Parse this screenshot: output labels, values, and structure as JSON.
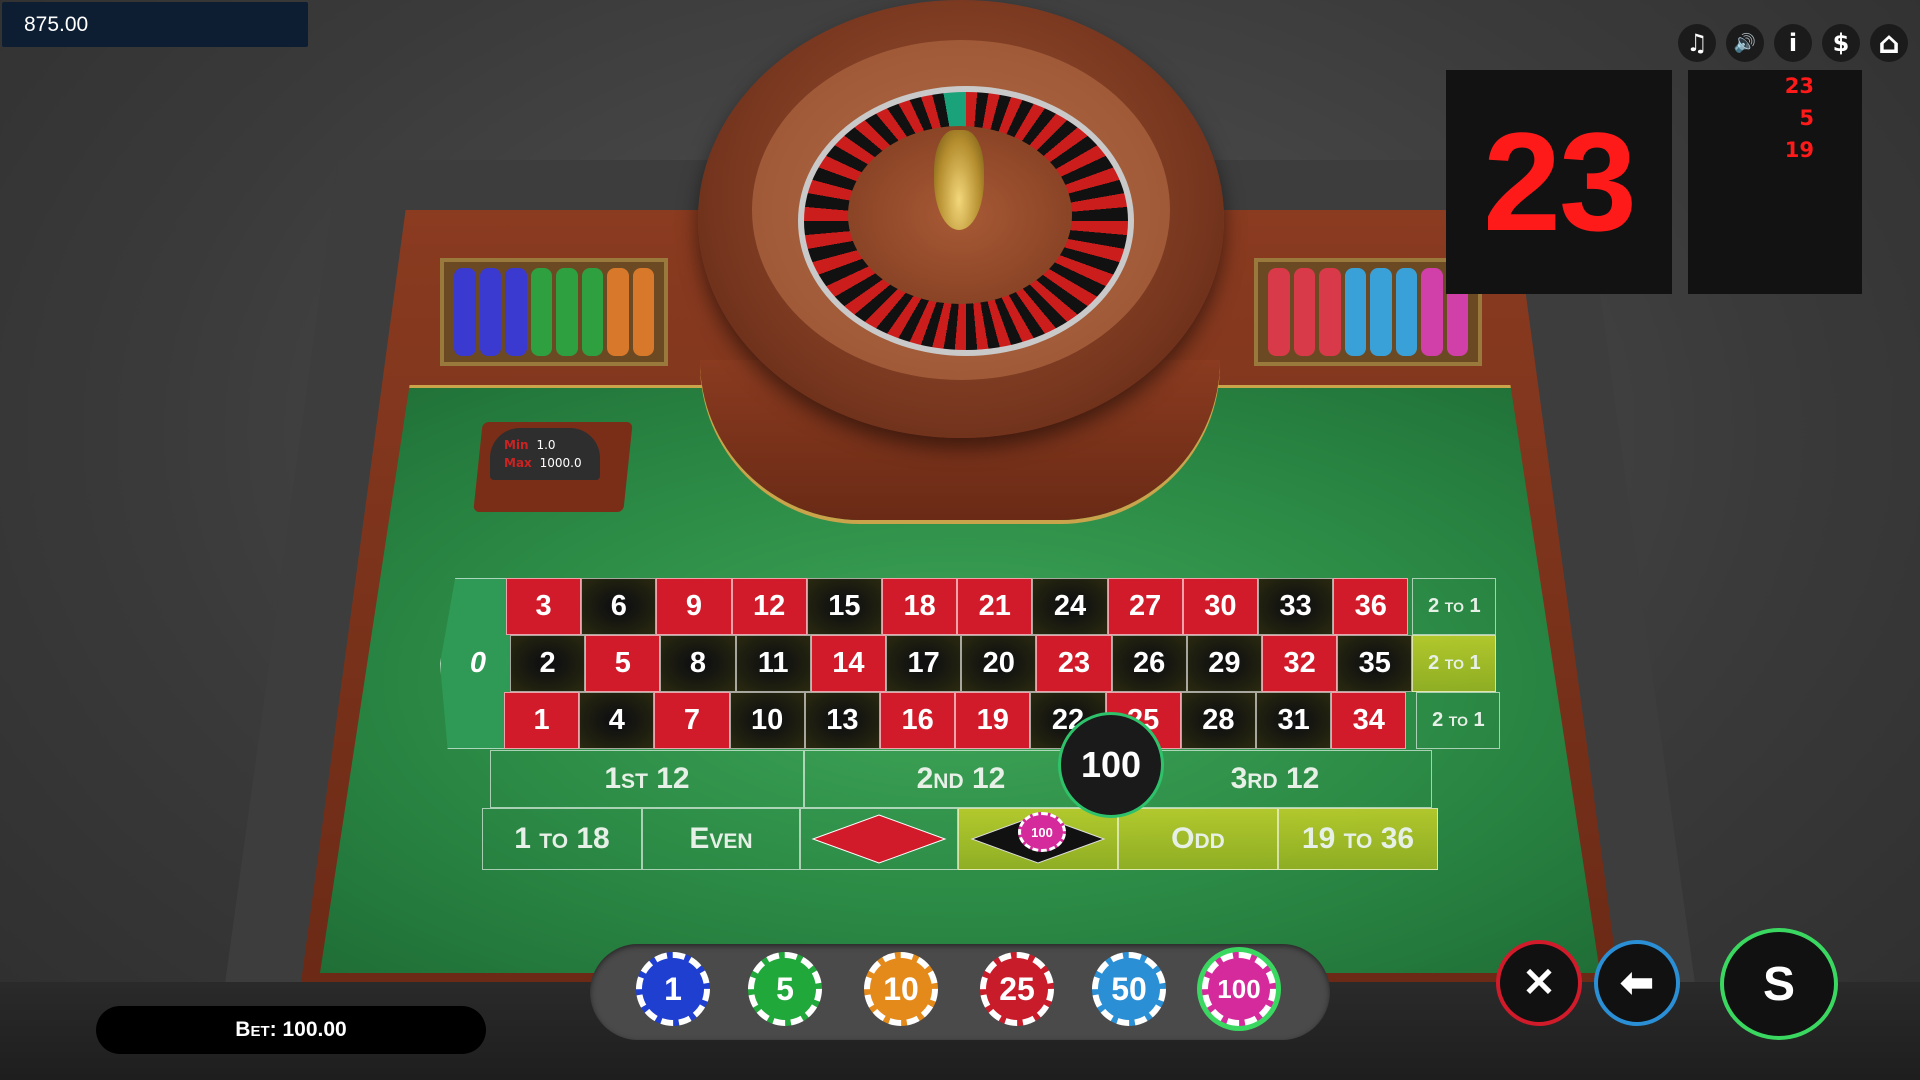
{
  "balance": "875.00",
  "top_icons": [
    {
      "name": "music-icon",
      "glyph": "♫"
    },
    {
      "name": "sound-icon",
      "glyph": "🔊"
    },
    {
      "name": "info-icon",
      "glyph": "i"
    },
    {
      "name": "dollar-icon",
      "glyph": "$"
    },
    {
      "name": "home-icon",
      "glyph": "⌂"
    }
  ],
  "result": {
    "current": "23",
    "history": [
      "23",
      "5",
      "19"
    ],
    "color": "#ff1a1a"
  },
  "limits": {
    "min_label": "Min",
    "min_value": "1.0",
    "max_label": "Max",
    "max_value": "1000.0"
  },
  "board": {
    "zero": "0",
    "row_top": [
      "3",
      "6",
      "9",
      "12",
      "15",
      "18",
      "21",
      "24",
      "27",
      "30",
      "33",
      "36"
    ],
    "row_mid": [
      "2",
      "5",
      "8",
      "11",
      "14",
      "17",
      "20",
      "23",
      "26",
      "29",
      "32",
      "35"
    ],
    "row_bot": [
      "1",
      "4",
      "7",
      "10",
      "13",
      "16",
      "19",
      "22",
      "25",
      "28",
      "31",
      "34"
    ],
    "red_numbers": [
      "1",
      "3",
      "5",
      "7",
      "9",
      "12",
      "14",
      "16",
      "18",
      "19",
      "21",
      "23",
      "25",
      "27",
      "30",
      "32",
      "34",
      "36"
    ],
    "column_label": "2 to 1",
    "dozens": [
      "1st 12",
      "2nd 12",
      "3rd 12"
    ],
    "outside": {
      "low": "1 to 18",
      "even": "Even",
      "odd": "Odd",
      "high": "19 to 36"
    },
    "highlighted": [
      "23",
      "5",
      "20",
      "22",
      "24",
      "26",
      "29",
      "35",
      "14",
      "17",
      "31",
      "33",
      "6",
      "15",
      "8",
      "10",
      "11",
      "4",
      "black",
      "odd",
      "high",
      "column-mid"
    ]
  },
  "placed_bet": {
    "chip_value": "100",
    "on": "black"
  },
  "bet": {
    "label": "Bet:",
    "value": "100.00"
  },
  "chips": [
    {
      "value": "1",
      "color": "#1e3fd0"
    },
    {
      "value": "5",
      "color": "#21a83a"
    },
    {
      "value": "10",
      "color": "#e38a1a"
    },
    {
      "value": "25",
      "color": "#c91c2b"
    },
    {
      "value": "50",
      "color": "#2b8fd6"
    },
    {
      "value": "100",
      "color": "#d42a9b",
      "selected": true
    }
  ],
  "controls": {
    "clear_icon": "✕",
    "undo_icon": "⬅",
    "spin_label": "S"
  },
  "colors": {
    "felt": "#2b8a45",
    "red": "#d11b2a",
    "highlight": "#c8d228"
  }
}
